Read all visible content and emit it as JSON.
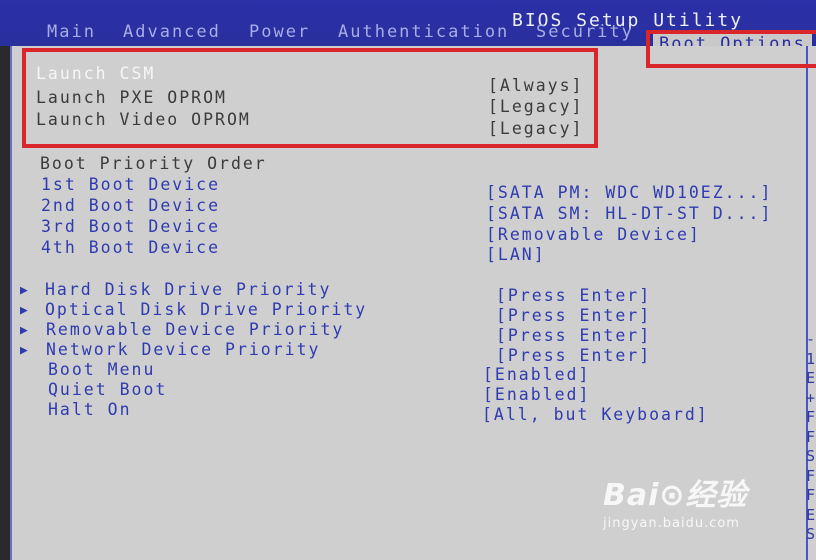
{
  "title": "BIOS Setup Utility",
  "tabs": [
    "Main",
    "Advanced",
    "Power",
    "Authentication",
    "Security",
    "Boot Options"
  ],
  "active_tab": "Boot Options",
  "csm_items": [
    {
      "label": "Launch CSM",
      "value": "[Always]"
    },
    {
      "label": "Launch PXE OPROM",
      "value": "[Legacy]"
    },
    {
      "label": "Launch Video OPROM",
      "value": "[Legacy]"
    }
  ],
  "boot_priority_heading": "Boot Priority Order",
  "boot_devices": [
    {
      "label": "1st Boot Device",
      "value": "[SATA  PM: WDC WD10EZ...]"
    },
    {
      "label": "2nd Boot Device",
      "value": "[SATA  SM: HL-DT-ST D...]"
    },
    {
      "label": "3rd Boot Device",
      "value": "[Removable Device]"
    },
    {
      "label": "4th Boot Device",
      "value": "[LAN]"
    }
  ],
  "submenus": [
    {
      "label": "Hard Disk Drive Priority",
      "value": "[Press Enter]"
    },
    {
      "label": "Optical Disk Drive Priority",
      "value": "[Press Enter]"
    },
    {
      "label": "Removable Device Priority",
      "value": "[Press Enter]"
    },
    {
      "label": "Network Device Priority",
      "value": "[Press Enter]"
    }
  ],
  "options": [
    {
      "label": "Boot Menu",
      "value": "[Enabled]"
    },
    {
      "label": "Quiet Boot",
      "value": "[Enabled]"
    },
    {
      "label": "Halt On",
      "value": "[All, but Keyboard]"
    }
  ],
  "side_help": [
    "-",
    "1",
    "E",
    "+",
    "F",
    "F",
    "S",
    "F",
    "F",
    "ES",
    "Se"
  ],
  "watermark": {
    "logo": "Bai⊙经验",
    "url": "jingyan.baidu.com"
  },
  "colors": {
    "header_blue": "#2a2f9e",
    "panel_gray": "#cfcfcf",
    "highlight_red": "#d8262b",
    "item_blue": "#2f3bb0"
  }
}
